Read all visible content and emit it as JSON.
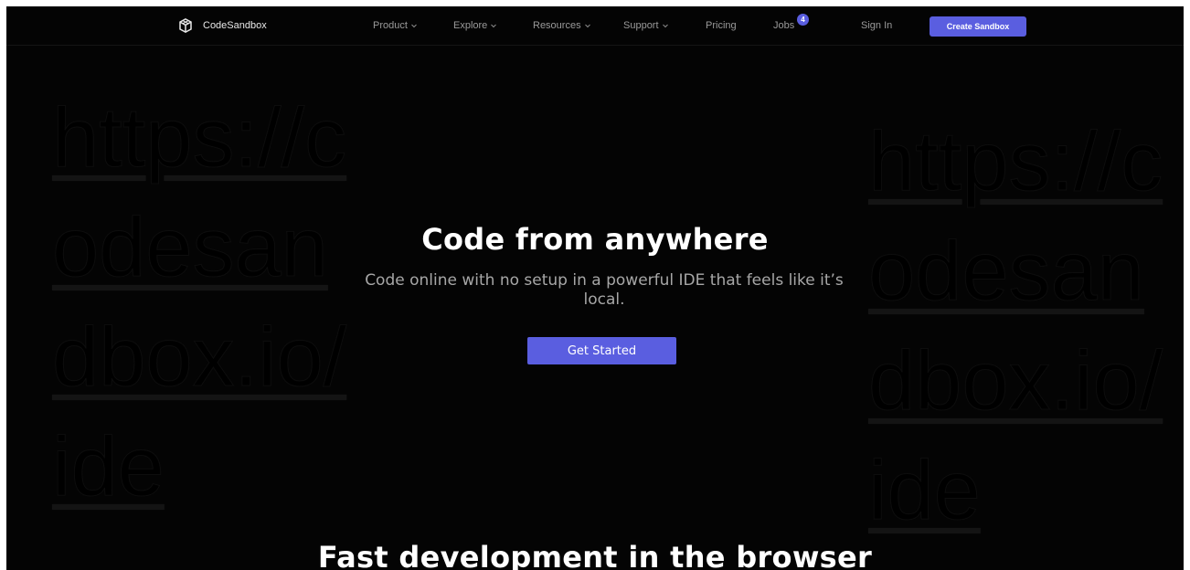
{
  "brand": {
    "name": "CodeSandbox",
    "logo_icon": "cube-logo-icon"
  },
  "nav": {
    "product": "Product",
    "explore": "Explore",
    "resources": "Resources",
    "support": "Support",
    "pricing": "Pricing",
    "jobs": "Jobs",
    "jobs_badge": "4",
    "sign_in": "Sign In",
    "create_sandbox": "Create Sandbox"
  },
  "background": {
    "left_url": "https://codesandbox.io/ide",
    "right_url": "https://codesandbox.io/ide"
  },
  "hero": {
    "title": "Code from anywhere",
    "subtitle": "Code online with no setup in a powerful IDE that feels like it’s local.",
    "cta": "Get Started"
  },
  "section": {
    "title": "Fast development in the browser"
  },
  "colors": {
    "background": "#040404",
    "accent": "#5a5ee0",
    "nav_text": "#9a9a9a",
    "title_text": "#ffffff",
    "subtitle_text": "#a7a7a7"
  }
}
